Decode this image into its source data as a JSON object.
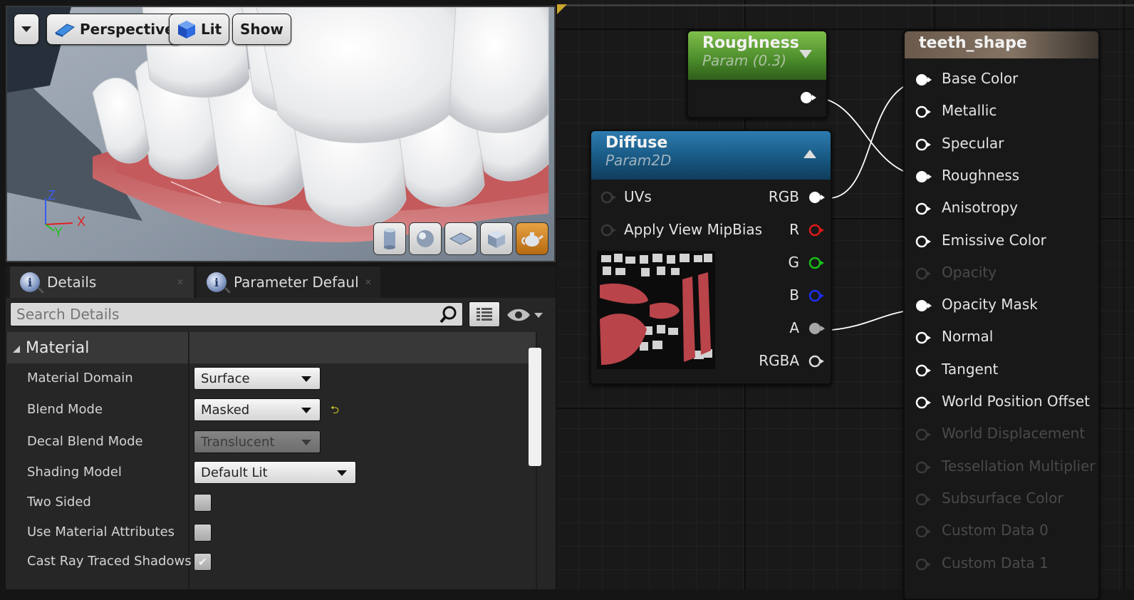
{
  "viewport": {
    "menu_button": "",
    "perspective_label": "Perspective",
    "lit_label": "Lit",
    "show_label": "Show",
    "axis": {
      "x": "X",
      "y": "Y",
      "z": "Z"
    },
    "tools": [
      "cylinder-icon",
      "sphere-icon",
      "plane-icon",
      "cube-icon",
      "teapot-icon"
    ]
  },
  "details": {
    "tabs": [
      {
        "label": "Details"
      },
      {
        "label": "Parameter Defaults"
      }
    ],
    "search_placeholder": "Search Details",
    "category": "Material",
    "properties": [
      {
        "label": "Material Domain",
        "type": "dropdown",
        "value": "Surface"
      },
      {
        "label": "Blend Mode",
        "type": "dropdown",
        "value": "Masked",
        "reset": "⮌"
      },
      {
        "label": "Decal Blend Mode",
        "type": "dropdown",
        "value": "Translucent",
        "disabled": true
      },
      {
        "label": "Shading Model",
        "type": "dropdown",
        "value": "Default Lit"
      },
      {
        "label": "Two Sided",
        "type": "checkbox",
        "checked": false
      },
      {
        "label": "Use Material Attributes",
        "type": "checkbox",
        "checked": false
      },
      {
        "label": "Cast Ray Traced Shadows",
        "type": "checkbox",
        "checked": true,
        "check_glyph": "✔"
      }
    ]
  },
  "graph": {
    "roughness_node": {
      "title": "Roughness",
      "subtitle": "Param (0.3)"
    },
    "diffuse_node": {
      "title": "Diffuse",
      "subtitle": "Param2D",
      "inputs": [
        "UVs",
        "Apply View MipBias"
      ],
      "outputs": [
        "RGB",
        "R",
        "G",
        "B",
        "A",
        "RGBA"
      ]
    },
    "result_node": {
      "title": "teeth_shape",
      "pins": [
        {
          "label": "Base Color",
          "state": "connected"
        },
        {
          "label": "Metallic",
          "state": "open"
        },
        {
          "label": "Specular",
          "state": "open"
        },
        {
          "label": "Roughness",
          "state": "connected"
        },
        {
          "label": "Anisotropy",
          "state": "open"
        },
        {
          "label": "Emissive Color",
          "state": "open"
        },
        {
          "label": "Opacity",
          "state": "disabled"
        },
        {
          "label": "Opacity Mask",
          "state": "connected"
        },
        {
          "label": "Normal",
          "state": "open"
        },
        {
          "label": "Tangent",
          "state": "open"
        },
        {
          "label": "World Position Offset",
          "state": "open"
        },
        {
          "label": "World Displacement",
          "state": "disabled"
        },
        {
          "label": "Tessellation Multiplier",
          "state": "disabled"
        },
        {
          "label": "Subsurface Color",
          "state": "disabled"
        },
        {
          "label": "Custom Data 0",
          "state": "disabled"
        },
        {
          "label": "Custom Data 1",
          "state": "disabled"
        }
      ]
    },
    "colors": {
      "r": "#e01818",
      "g": "#16c216",
      "b": "#1c2ff0",
      "a": "#a6a6a6",
      "white": "#ffffff"
    }
  }
}
